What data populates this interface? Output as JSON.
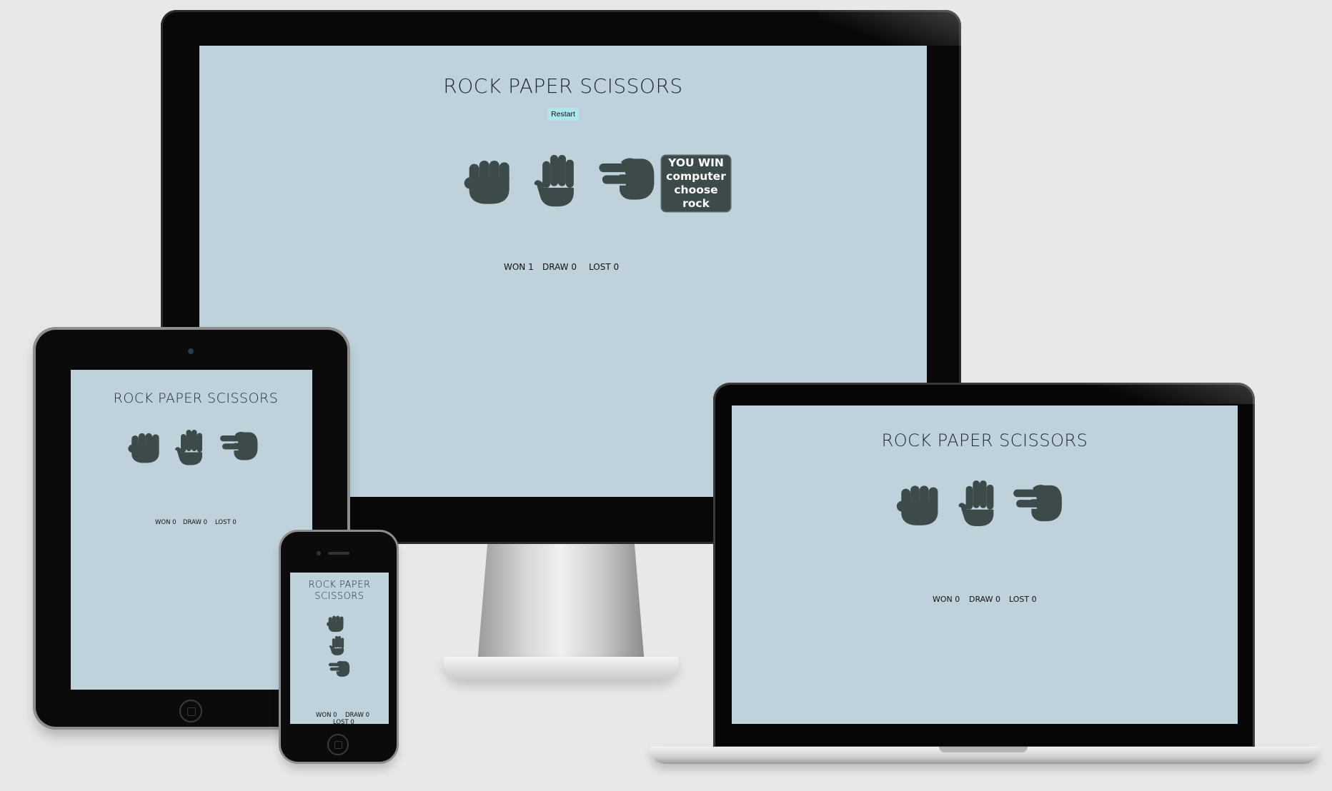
{
  "app": {
    "title": "ROCK PAPER SCISSORS",
    "title_line1": "ROCK PAPER",
    "title_line2": "SCISSORS",
    "restart_label": "Restart",
    "hand_color": "#3d4a4a",
    "screen_color": "#bfd2dc",
    "choices": [
      {
        "name": "rock",
        "icon": "fist-icon"
      },
      {
        "name": "paper",
        "icon": "hand-paper-icon"
      },
      {
        "name": "scissors",
        "icon": "hand-scissors-icon"
      }
    ]
  },
  "monitor": {
    "result": {
      "headline": "YOU WIN",
      "detail": [
        "computer",
        "choose",
        "rock"
      ]
    },
    "score": {
      "won": "WON 1",
      "draw": "DRAW 0",
      "lost": "LOST 0"
    }
  },
  "laptop": {
    "score": {
      "won": "WON 0",
      "draw": "DRAW 0",
      "lost": "LOST 0"
    }
  },
  "tablet": {
    "score": {
      "won": "WON 0",
      "draw": "DRAW 0",
      "lost": "LOST 0"
    }
  },
  "phone": {
    "score": {
      "won": "WON 0",
      "draw": "DRAW 0",
      "lost": "LOST 0"
    }
  }
}
